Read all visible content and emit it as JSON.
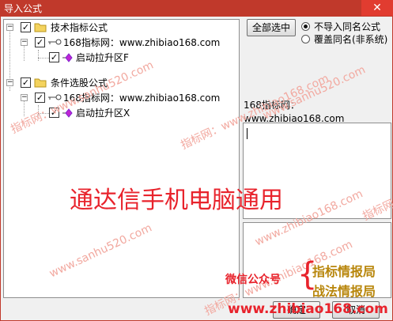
{
  "window": {
    "title": "导入公式",
    "close_glyph": "✕"
  },
  "tree": {
    "nodes": [
      {
        "label": "技术指标公式",
        "expander": "−",
        "checked": true
      },
      {
        "label": "168指标网：www.zhibiao168.com",
        "expander": "−",
        "checked": true
      },
      {
        "label": "启动拉升区F",
        "checked": true
      },
      {
        "label": "条件选股公式",
        "expander": "−",
        "checked": true
      },
      {
        "label": "168指标网：www.zhibiao168.com",
        "expander": "−",
        "checked": true
      },
      {
        "label": "启动拉升区X",
        "checked": true
      }
    ]
  },
  "right": {
    "select_all_label": "全部选中",
    "radio_options": [
      {
        "label": "不导入同名公式",
        "selected": true
      },
      {
        "label": "覆盖同名(非系统)",
        "selected": false
      }
    ],
    "info_line1": "168指标网：",
    "info_line2": "www.zhibiao168.com"
  },
  "overlay": {
    "big_text": "通达信手机电脑通用",
    "wechat_label": "微信公众号",
    "brace": "{",
    "item1": "指标情报局",
    "item2": "战法情报局",
    "url": "www.zhibiao168.com",
    "watermarks": [
      "指标网：www.sanhu520.com",
      "www.sanhu520.com",
      "指标网：www.zhibiao168.com",
      "指标网：www.zhibiao168.com",
      "www.sanhu520.com",
      "www.zhibiao168.com",
      "指标网"
    ]
  },
  "footer": {
    "ok_label": "确定",
    "cancel_label": "取消"
  },
  "colors": {
    "title_bar": "#c0392b",
    "overlay_red": "#e8232c",
    "overlay_gold": "#b8860b"
  }
}
